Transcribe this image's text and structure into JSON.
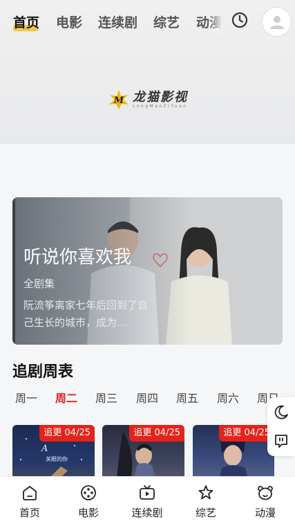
{
  "tabs": [
    "首页",
    "电影",
    "连续剧",
    "综艺",
    "动漫"
  ],
  "logo": {
    "title": "龙猫影视",
    "subtitle": "LongMaoZiYuan"
  },
  "banner": {
    "title": "听说你喜欢我",
    "episodes": "全剧集",
    "description": "阮流筝离家七年后回到了自己生长的城市，成为..."
  },
  "schedule": {
    "title": "追剧周表",
    "days": [
      "周一",
      "周二",
      "周三",
      "周四",
      "周五",
      "周六",
      "周日"
    ],
    "active_day": "周二"
  },
  "posters": [
    {
      "badge": "追更 04/25",
      "art_text": "关眼的你"
    },
    {
      "badge": "追更 04/25"
    },
    {
      "badge": "追更 04/25"
    }
  ],
  "bottom_nav": [
    "首页",
    "电影",
    "连续剧",
    "综艺",
    "动漫"
  ],
  "colors": {
    "accent_red": "#e02020",
    "tab_highlight": "#f7c544",
    "badge_red": "#e5231b"
  }
}
